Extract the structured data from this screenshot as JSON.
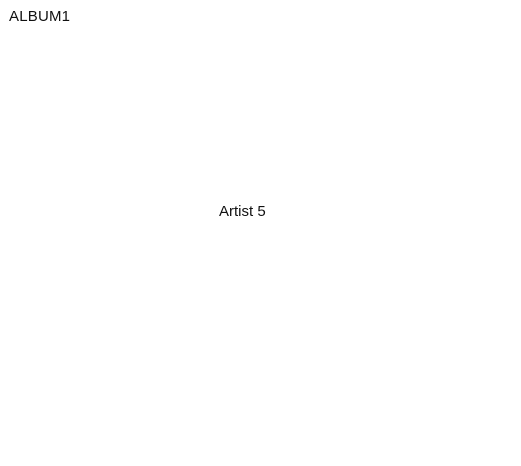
{
  "album": {
    "title": "ALBUM1"
  },
  "artist": {
    "name": "Artist 5"
  }
}
